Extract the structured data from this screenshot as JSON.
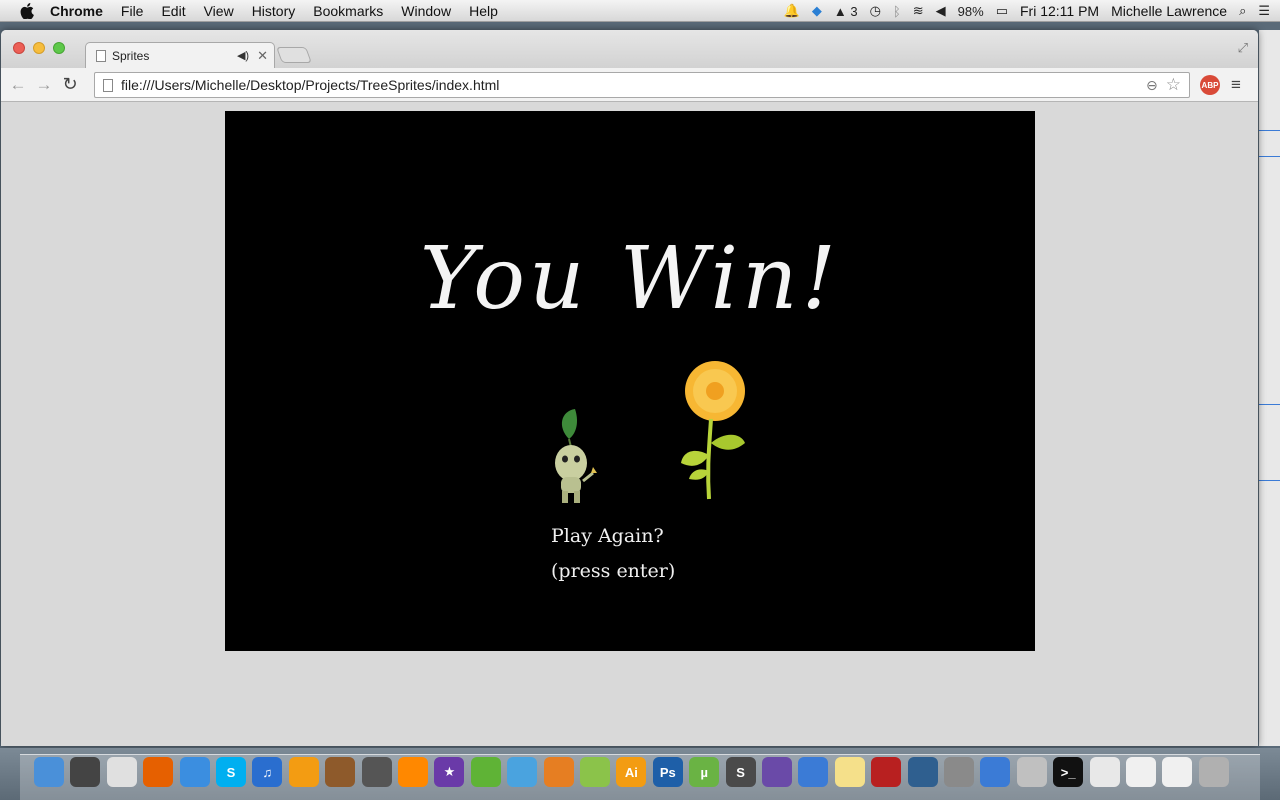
{
  "menubar": {
    "app_name": "Chrome",
    "menus": [
      "File",
      "Edit",
      "View",
      "History",
      "Bookmarks",
      "Window",
      "Help"
    ],
    "status": {
      "adobe_count": "3",
      "battery": "98%",
      "clock": "Fri 12:11 PM",
      "user": "Michelle Lawrence"
    }
  },
  "browser": {
    "tab_title": "Sprites",
    "url": "file:///Users/Michelle/Desktop/Projects/TreeSprites/index.html",
    "abp_label": "ABP"
  },
  "game": {
    "title": "You Win!",
    "play_again": "Play Again?",
    "press_enter": "(press enter)",
    "colors": {
      "background": "#000000",
      "text": "#f4f4f4",
      "petal": "#f7b733",
      "leaf": "#b8d43a"
    }
  },
  "dock": {
    "icons": [
      {
        "name": "finder-icon",
        "color": "#4a90d9",
        "label": ""
      },
      {
        "name": "dashboard-icon",
        "color": "#444444",
        "label": ""
      },
      {
        "name": "chrome-icon",
        "color": "#e0e0e0",
        "label": ""
      },
      {
        "name": "firefox-icon",
        "color": "#e66000",
        "label": ""
      },
      {
        "name": "safari-icon",
        "color": "#3b8ee0",
        "label": ""
      },
      {
        "name": "skype-icon",
        "color": "#00aff0",
        "label": "S"
      },
      {
        "name": "itunes-icon",
        "color": "#2a6ecf",
        "label": "♫"
      },
      {
        "name": "ibooks-icon",
        "color": "#f39c12",
        "label": ""
      },
      {
        "name": "garageband-icon",
        "color": "#8e5a2b",
        "label": ""
      },
      {
        "name": "iphoto-icon",
        "color": "#555555",
        "label": ""
      },
      {
        "name": "vlc-icon",
        "color": "#ff8800",
        "label": ""
      },
      {
        "name": "imovie-icon",
        "color": "#6a3aa8",
        "label": "★"
      },
      {
        "name": "evernote-icon",
        "color": "#5fb336",
        "label": ""
      },
      {
        "name": "dreamweaver-icon",
        "color": "#4aa3df",
        "label": ""
      },
      {
        "name": "fireworks-icon",
        "color": "#e67e22",
        "label": ""
      },
      {
        "name": "flash-icon",
        "color": "#8bc34a",
        "label": ""
      },
      {
        "name": "illustrator-icon",
        "color": "#f39c12",
        "label": "Ai"
      },
      {
        "name": "photoshop-icon",
        "color": "#1e5fa8",
        "label": "Ps"
      },
      {
        "name": "utorrent-icon",
        "color": "#6ab344",
        "label": "µ"
      },
      {
        "name": "sublime-icon",
        "color": "#4a4a4a",
        "label": "S"
      },
      {
        "name": "eclipse-icon",
        "color": "#6a4aa8",
        "label": ""
      },
      {
        "name": "preview-icon",
        "color": "#3b7bd6",
        "label": ""
      },
      {
        "name": "stickies-icon",
        "color": "#f5e08a",
        "label": ""
      },
      {
        "name": "photobooth-icon",
        "color": "#b82020",
        "label": ""
      },
      {
        "name": "time-machine-icon",
        "color": "#2f5f8f",
        "label": ""
      },
      {
        "name": "system-preferences-icon",
        "color": "#8a8a8a",
        "label": ""
      },
      {
        "name": "directory-utility-icon",
        "color": "#3b7bd6",
        "label": ""
      },
      {
        "name": "image-capture-icon",
        "color": "#c0c0c0",
        "label": ""
      },
      {
        "name": "terminal-icon",
        "color": "#111111",
        "label": ">_"
      },
      {
        "name": "document-icon",
        "color": "#e8e8e8",
        "label": ""
      },
      {
        "name": "chrome-window-icon",
        "color": "#f0f0f0",
        "label": ""
      },
      {
        "name": "chrome-window-icon-2",
        "color": "#f0f0f0",
        "label": ""
      },
      {
        "name": "trash-icon",
        "color": "#b0b0b0",
        "label": ""
      }
    ]
  }
}
